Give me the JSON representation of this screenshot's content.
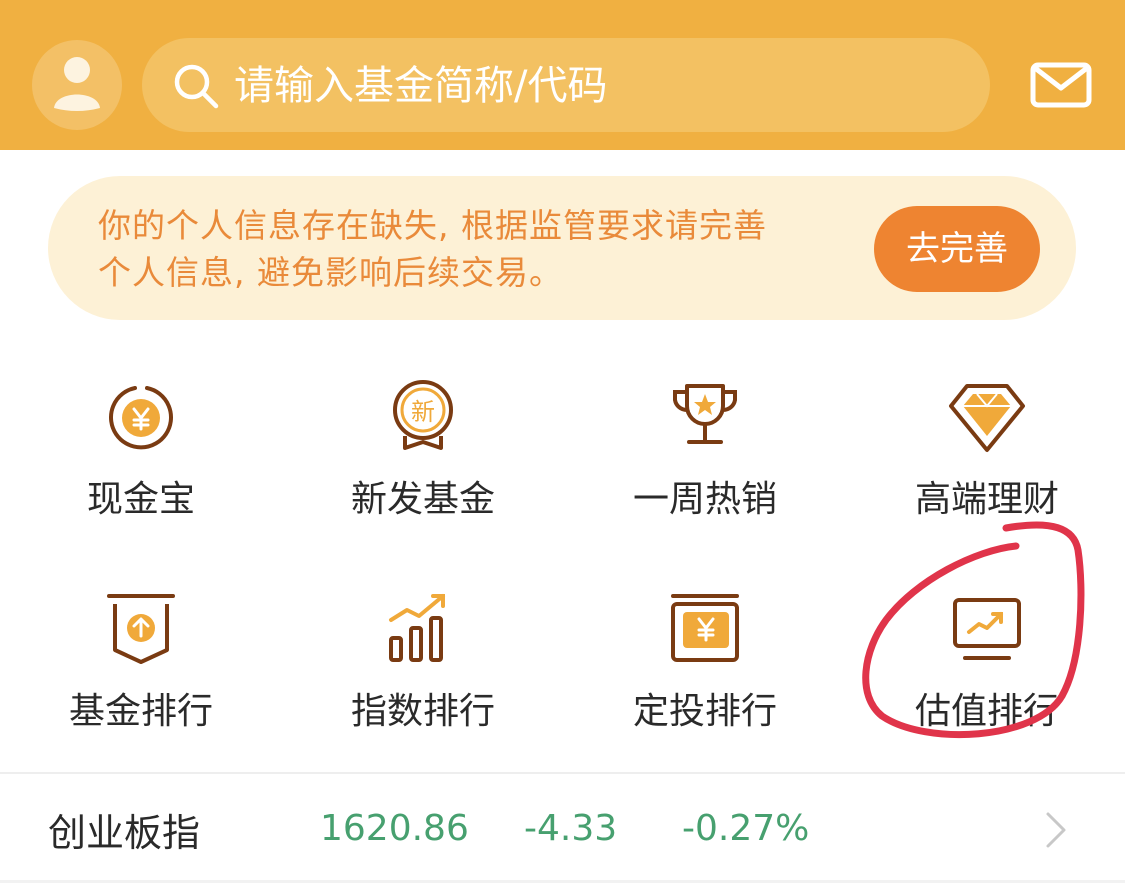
{
  "header": {
    "search_placeholder": "请输入基金简称/代码",
    "accent_color": "#f0b041"
  },
  "notice": {
    "line1": "你的个人信息存在缺失, 根据监管要求请完善",
    "line2": "个人信息, 避免影响后续交易。",
    "button": "去完善"
  },
  "grid": [
    {
      "label": "现金宝",
      "icon": "yuan-coin-icon"
    },
    {
      "label": "新发基金",
      "icon": "new-badge-icon"
    },
    {
      "label": "一周热销",
      "icon": "trophy-icon"
    },
    {
      "label": "高端理财",
      "icon": "diamond-icon"
    },
    {
      "label": "基金排行",
      "icon": "upload-arrow-icon"
    },
    {
      "label": "指数排行",
      "icon": "bar-chart-trend-icon"
    },
    {
      "label": "定投排行",
      "icon": "yuan-calendar-icon"
    },
    {
      "label": "估值排行",
      "icon": "trend-monitor-icon"
    }
  ],
  "index_row": {
    "name": "创业板指",
    "value": "1620.86",
    "change": "-4.33",
    "change_pct": "-0.27%",
    "value_color": "#47a06f"
  },
  "annotation_color": "#e0344a"
}
